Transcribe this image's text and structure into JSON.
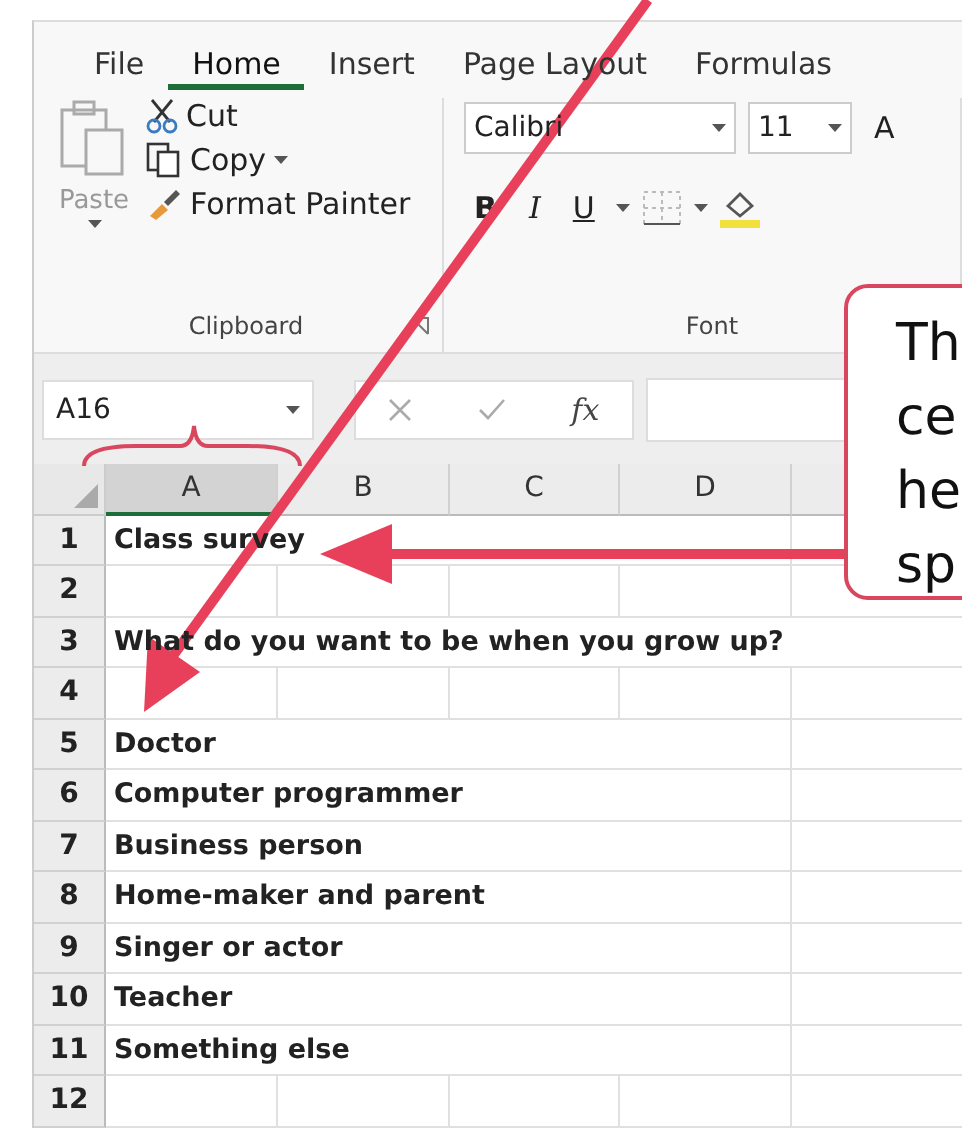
{
  "ribbon_tabs": [
    {
      "label": "File",
      "selected": false
    },
    {
      "label": "Home",
      "selected": true
    },
    {
      "label": "Insert",
      "selected": false
    },
    {
      "label": "Page Layout",
      "selected": false
    },
    {
      "label": "Formulas",
      "selected": false
    }
  ],
  "clipboard": {
    "paste": "Paste",
    "cut": "Cut",
    "copy": "Copy",
    "format_painter": "Format Painter",
    "group_label": "Clipboard"
  },
  "font": {
    "name": "Calibri",
    "size": "11",
    "grow": "A",
    "bold": "B",
    "italic": "I",
    "underline": "U",
    "group_label": "Font"
  },
  "formula_bar": {
    "name_box": "A16",
    "fx": "fx"
  },
  "columns": [
    {
      "label": "A",
      "selected": true
    },
    {
      "label": "B",
      "selected": false
    },
    {
      "label": "C",
      "selected": false
    },
    {
      "label": "D",
      "selected": false
    }
  ],
  "rows": [
    {
      "number": "1",
      "text": "Class survey"
    },
    {
      "number": "2"
    },
    {
      "number": "3",
      "text": "What do you want to be when you grow up?"
    },
    {
      "number": "4"
    },
    {
      "number": "5",
      "text": "Doctor"
    },
    {
      "number": "6",
      "text": "Computer programmer"
    },
    {
      "number": "7",
      "text": "Business person"
    },
    {
      "number": "8",
      "text": "Home-maker and parent"
    },
    {
      "number": "9",
      "text": "Singer or actor"
    },
    {
      "number": "10",
      "text": "Teacher"
    },
    {
      "number": "11",
      "text": "Something else"
    },
    {
      "number": "12"
    }
  ],
  "callout": {
    "lines": [
      "Th",
      "ce",
      "he",
      "sp"
    ]
  }
}
